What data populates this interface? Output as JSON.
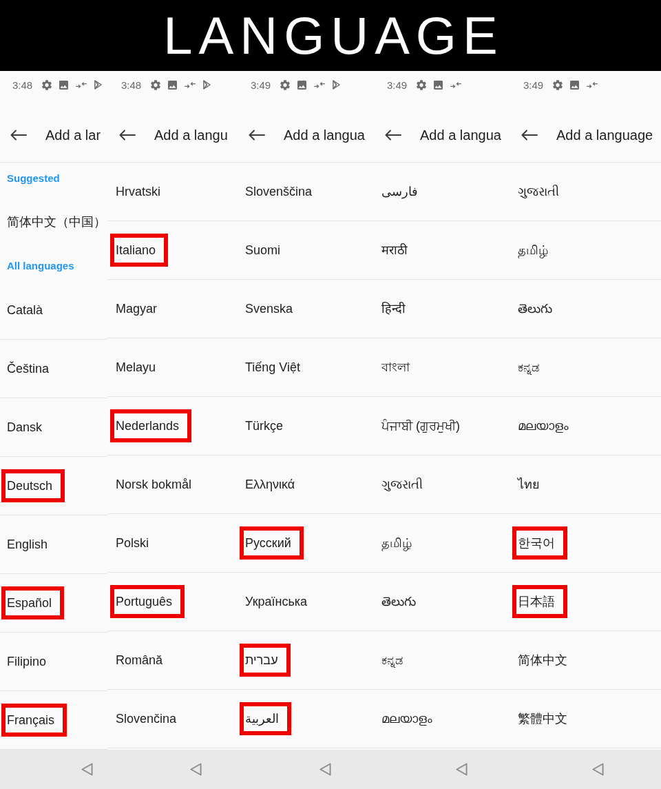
{
  "banner": {
    "title": "LANGUAGE"
  },
  "panels": [
    {
      "status_bar": {
        "time": "3:48",
        "icons": [
          {
            "kind": "settings"
          },
          {
            "kind": "image"
          },
          {
            "kind": "arrows"
          },
          {
            "kind": "play"
          }
        ]
      },
      "header": {
        "title": "Add a lar"
      },
      "items": [
        {
          "kind": "header",
          "label": "Suggested",
          "highlighted": false
        },
        {
          "kind": "language",
          "label": "简体中文（中国）",
          "highlighted": false
        },
        {
          "kind": "header",
          "label": "All languages",
          "highlighted": false
        },
        {
          "kind": "language",
          "label": "Català",
          "highlighted": false
        },
        {
          "kind": "language",
          "label": "Čeština",
          "highlighted": false
        },
        {
          "kind": "language",
          "label": "Dansk",
          "highlighted": false
        },
        {
          "kind": "language",
          "label": "Deutsch",
          "highlighted": true
        },
        {
          "kind": "language",
          "label": "English",
          "highlighted": false
        },
        {
          "kind": "language",
          "label": "Español",
          "highlighted": true
        },
        {
          "kind": "language",
          "label": "Filipino",
          "highlighted": false
        },
        {
          "kind": "language",
          "label": "Français",
          "highlighted": true
        }
      ]
    },
    {
      "status_bar": {
        "time": "3:48",
        "icons": [
          {
            "kind": "settings"
          },
          {
            "kind": "image"
          },
          {
            "kind": "arrows"
          },
          {
            "kind": "play"
          }
        ]
      },
      "header": {
        "title": "Add a langu"
      },
      "items": [
        {
          "kind": "language",
          "label": "Hrvatski",
          "highlighted": false
        },
        {
          "kind": "language",
          "label": "Italiano",
          "highlighted": true
        },
        {
          "kind": "language",
          "label": "Magyar",
          "highlighted": false
        },
        {
          "kind": "language",
          "label": "Melayu",
          "highlighted": false
        },
        {
          "kind": "language",
          "label": "Nederlands",
          "highlighted": true
        },
        {
          "kind": "language",
          "label": "Norsk bokmål",
          "highlighted": false
        },
        {
          "kind": "language",
          "label": "Polski",
          "highlighted": false
        },
        {
          "kind": "language",
          "label": "Português",
          "highlighted": true
        },
        {
          "kind": "language",
          "label": "Română",
          "highlighted": false
        },
        {
          "kind": "language",
          "label": "Slovenčina",
          "highlighted": false
        }
      ]
    },
    {
      "status_bar": {
        "time": "3:49",
        "icons": [
          {
            "kind": "settings"
          },
          {
            "kind": "image"
          },
          {
            "kind": "arrows"
          },
          {
            "kind": "play"
          }
        ]
      },
      "header": {
        "title": "Add a langua"
      },
      "items": [
        {
          "kind": "language",
          "label": "Slovenščina",
          "highlighted": false
        },
        {
          "kind": "language",
          "label": "Suomi",
          "highlighted": false
        },
        {
          "kind": "language",
          "label": "Svenska",
          "highlighted": false
        },
        {
          "kind": "language",
          "label": "Tiếng Việt",
          "highlighted": false
        },
        {
          "kind": "language",
          "label": "Türkçe",
          "highlighted": false
        },
        {
          "kind": "language",
          "label": "Ελληνικά",
          "highlighted": false
        },
        {
          "kind": "language",
          "label": "Русский",
          "highlighted": true
        },
        {
          "kind": "language",
          "label": "Українська",
          "highlighted": false
        },
        {
          "kind": "language",
          "label": "עברית",
          "highlighted": true
        },
        {
          "kind": "language",
          "label": "العربية",
          "highlighted": true
        }
      ]
    },
    {
      "status_bar": {
        "time": "3:49",
        "icons": [
          {
            "kind": "settings"
          },
          {
            "kind": "image"
          },
          {
            "kind": "arrows"
          }
        ]
      },
      "header": {
        "title": "Add a langua"
      },
      "items": [
        {
          "kind": "language",
          "label": "فارسی",
          "highlighted": false
        },
        {
          "kind": "language",
          "label": "मराठी",
          "highlighted": false
        },
        {
          "kind": "language",
          "label": "हिन्दी",
          "highlighted": false
        },
        {
          "kind": "language",
          "label": "বাংলা",
          "highlighted": false
        },
        {
          "kind": "language",
          "label": "ਪੰਜਾਬੀ (ਗੁਰਮੁਖੀ)",
          "highlighted": false
        },
        {
          "kind": "language",
          "label": "ગુજરાતી",
          "highlighted": false
        },
        {
          "kind": "language",
          "label": "தமிழ்",
          "highlighted": false
        },
        {
          "kind": "language",
          "label": "తెలుగు",
          "highlighted": false
        },
        {
          "kind": "language",
          "label": "ಕನ್ನಡ",
          "highlighted": false
        },
        {
          "kind": "language",
          "label": "മലയാളം",
          "highlighted": false
        }
      ]
    },
    {
      "status_bar": {
        "time": "3:49",
        "icons": [
          {
            "kind": "settings"
          },
          {
            "kind": "image"
          },
          {
            "kind": "arrows"
          }
        ]
      },
      "header": {
        "title": "Add a language"
      },
      "items": [
        {
          "kind": "language",
          "label": "ગુજરાતી",
          "highlighted": false
        },
        {
          "kind": "language",
          "label": "தமிழ்",
          "highlighted": false
        },
        {
          "kind": "language",
          "label": "తెలుగు",
          "highlighted": false
        },
        {
          "kind": "language",
          "label": "ಕನ್ನಡ",
          "highlighted": false
        },
        {
          "kind": "language",
          "label": "മലയാളം",
          "highlighted": false
        },
        {
          "kind": "language",
          "label": "ไทย",
          "highlighted": false
        },
        {
          "kind": "language",
          "label": "한국어",
          "highlighted": true
        },
        {
          "kind": "language",
          "label": "日本語",
          "highlighted": true
        },
        {
          "kind": "language",
          "label": "简体中文",
          "highlighted": false
        },
        {
          "kind": "language",
          "label": "繁體中文",
          "highlighted": false
        }
      ]
    }
  ]
}
